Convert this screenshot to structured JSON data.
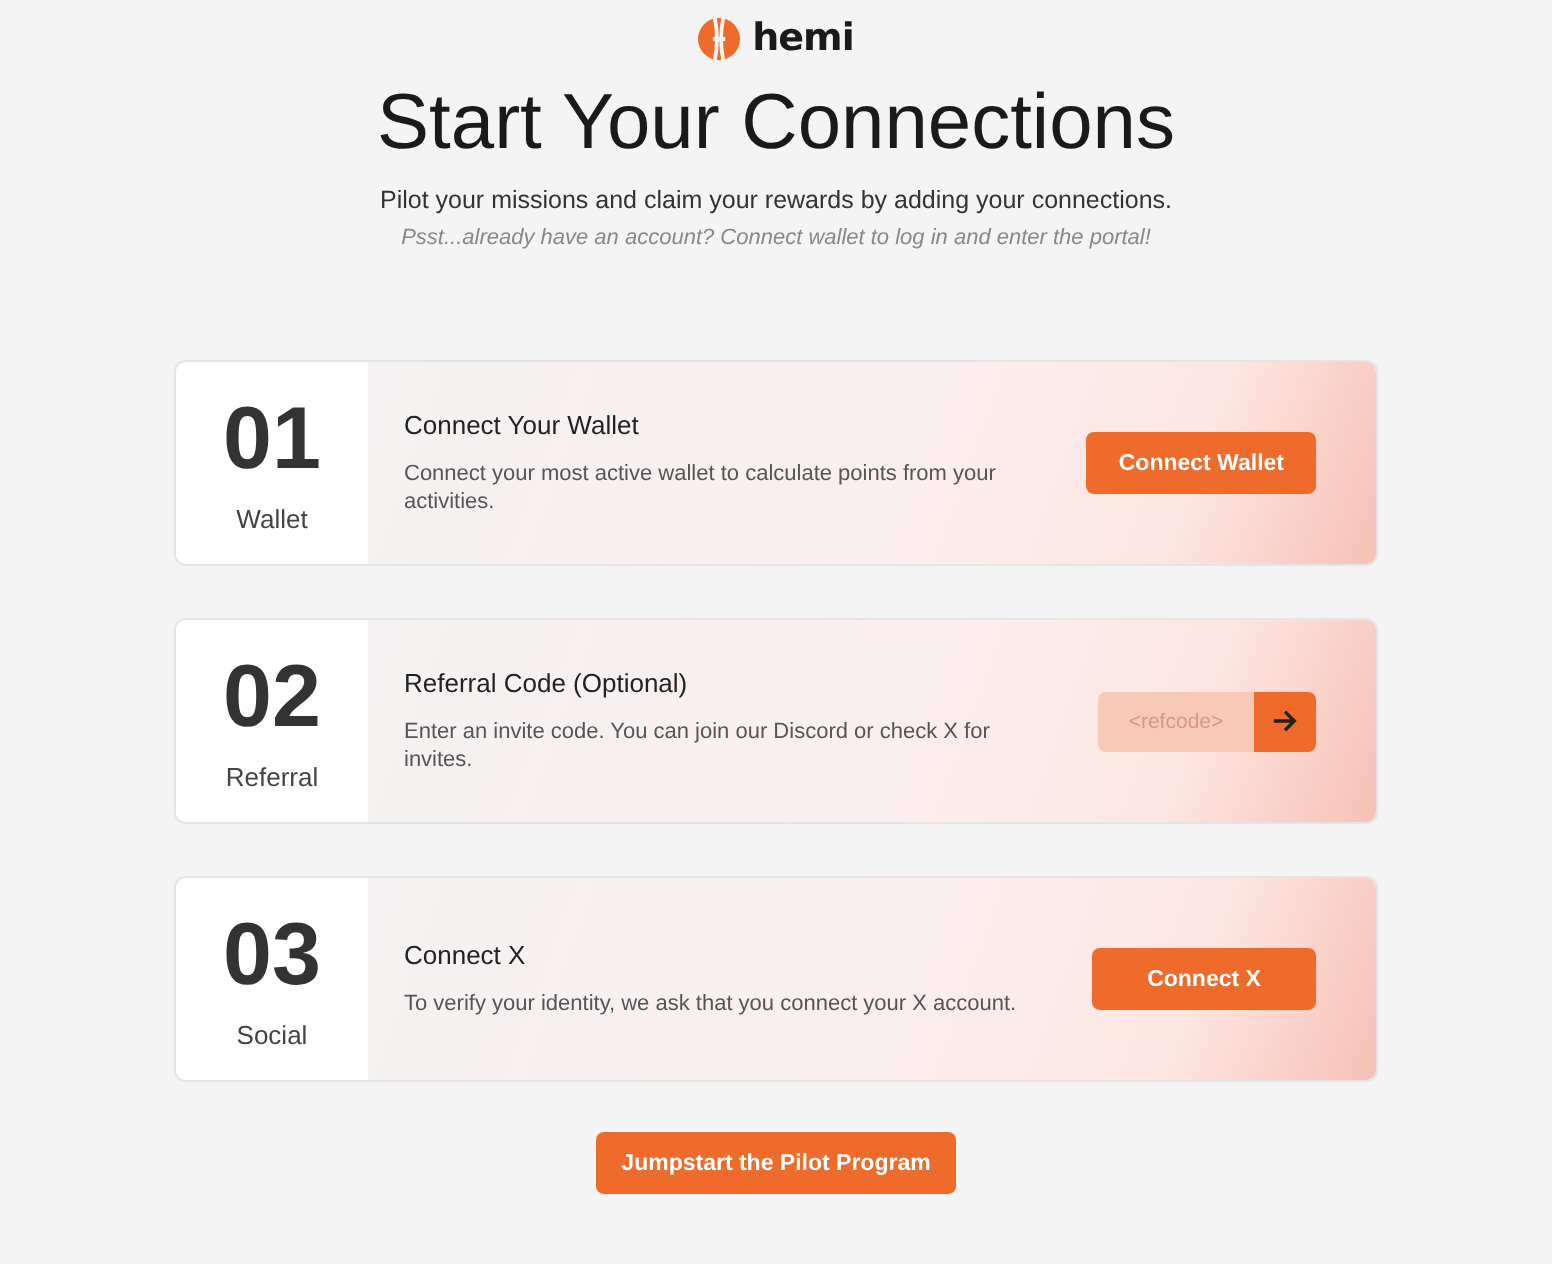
{
  "brand": {
    "name": "hemi"
  },
  "title": "Start Your Connections",
  "subtitle": "Pilot your missions and claim your rewards by adding your connections.",
  "hint": "Psst...already have an account? Connect wallet to log in and enter the portal!",
  "steps": [
    {
      "number": "01",
      "label": "Wallet",
      "heading": "Connect Your Wallet",
      "text": "Connect your most active wallet to calculate points from your activities.",
      "kind": "button",
      "action": "Connect Wallet"
    },
    {
      "number": "02",
      "label": "Referral",
      "heading": "Referral Code (Optional)",
      "text": "Enter an invite code. You can join our Discord or check X for invites.",
      "kind": "input",
      "placeholder": "<refcode>"
    },
    {
      "number": "03",
      "label": "Social",
      "heading": "Connect X",
      "text": "To verify your identity, we ask that you connect your X account.",
      "kind": "button",
      "action": "Connect X"
    }
  ],
  "cta": "Jumpstart the Pilot Program"
}
